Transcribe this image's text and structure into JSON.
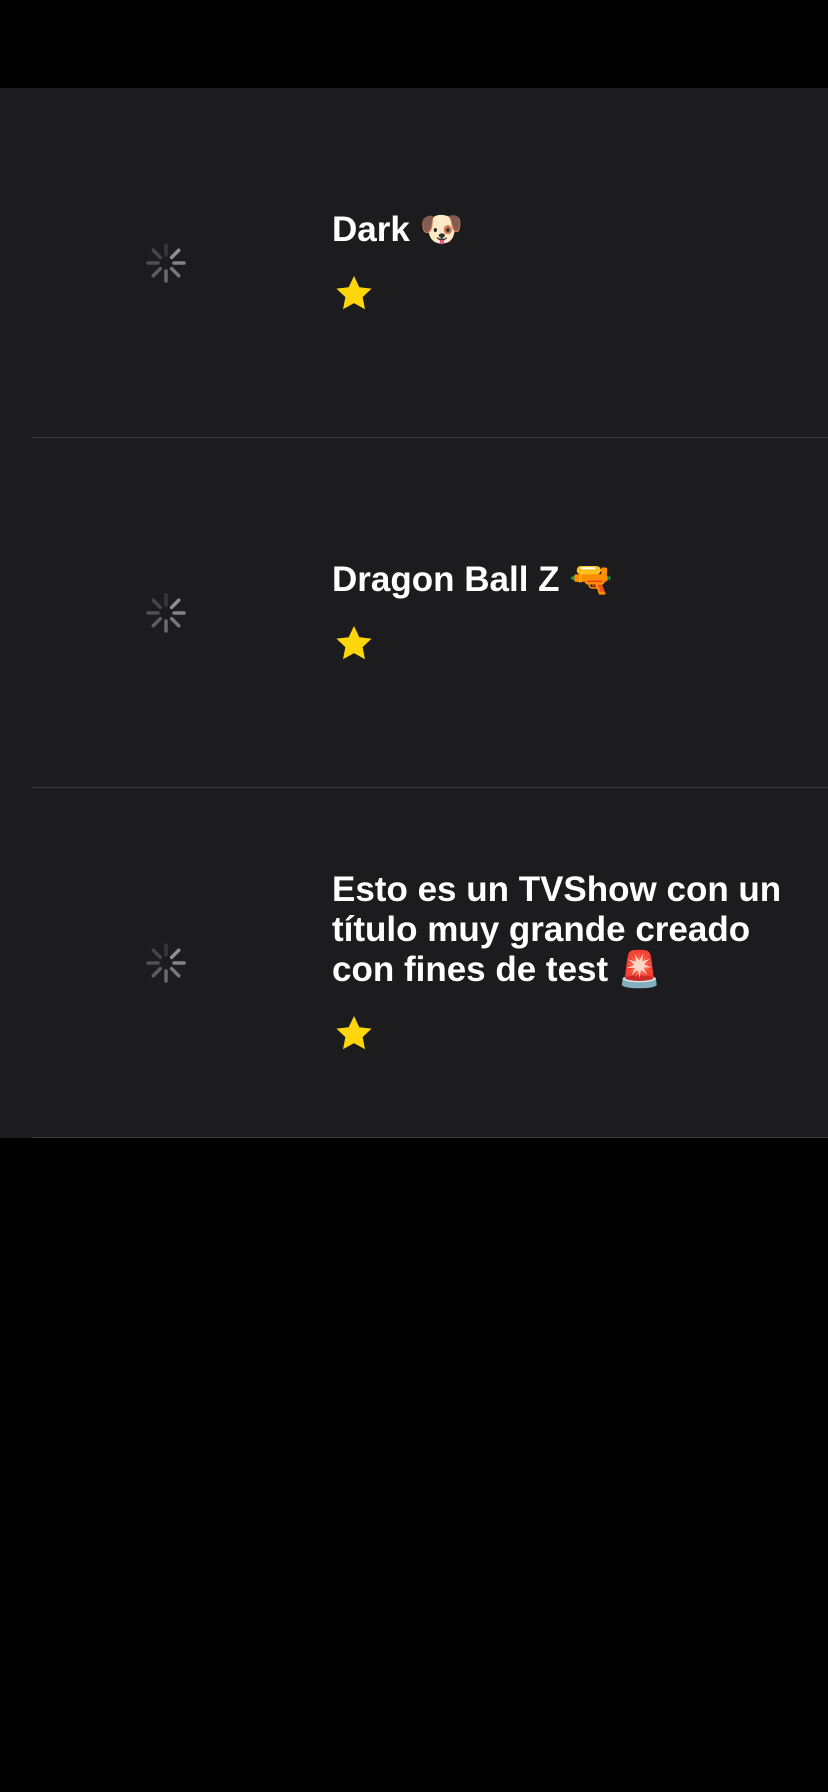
{
  "colors": {
    "background": "#000000",
    "list_background": "#1c1c1e",
    "separator": "#38383a",
    "title": "#ffffff",
    "star": "#ffd60a",
    "spinner": "#8e8e93"
  },
  "shows": [
    {
      "title": "Dark 🐶",
      "rating_icon": "star-icon",
      "thumbnail": "loading-spinner-icon"
    },
    {
      "title": "Dragon Ball Z 🔫",
      "rating_icon": "star-icon",
      "thumbnail": "loading-spinner-icon"
    },
    {
      "title": "Esto es un TVShow con un título muy grande creado con fines de test 🚨",
      "rating_icon": "star-icon",
      "thumbnail": "loading-spinner-icon"
    }
  ]
}
